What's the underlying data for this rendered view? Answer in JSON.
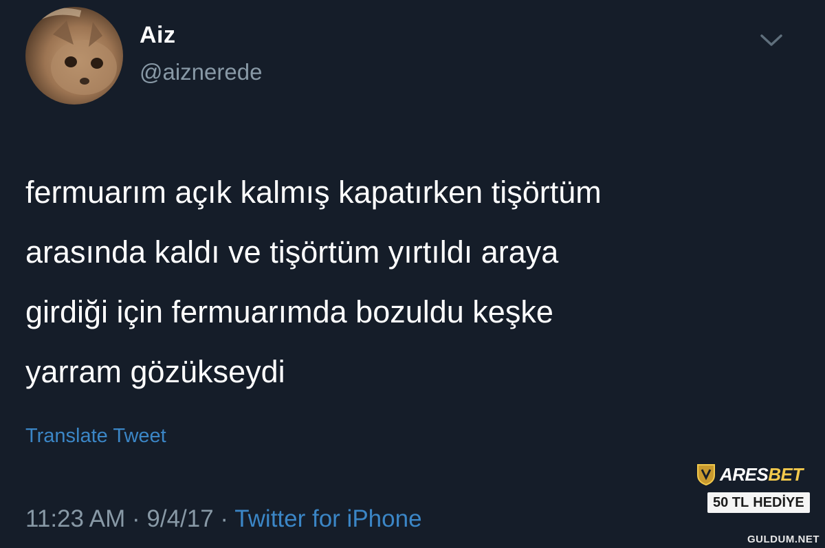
{
  "tweet": {
    "display_name": "Aiz",
    "handle": "@aiznerede",
    "text_lines": [
      "fermuarım açık kalmış kapatırken tişörtüm",
      "arasında kaldı ve tişörtüm yırtıldı araya",
      "girdiği için fermuarımda bozuldu keşke",
      "yarram gözükseydi"
    ],
    "translate_label": "Translate Tweet",
    "time": "11:23 AM",
    "separator": " · ",
    "date": "9/4/17",
    "source": "Twitter for iPhone",
    "menu_icon": "chevron-down-icon"
  },
  "ad": {
    "brand_prefix": "ARES",
    "brand_suffix": "BET",
    "gift_amount": "50 TL",
    "gift_word": "HEDİYE",
    "logo_icon": "shield-crest-icon"
  },
  "watermark": "GULDUM.NET",
  "colors": {
    "background": "#151d29",
    "primary_text": "#ffffff",
    "secondary_text": "#8899a6",
    "link": "#3b86c6",
    "ad_accent": "#f2c94c"
  }
}
